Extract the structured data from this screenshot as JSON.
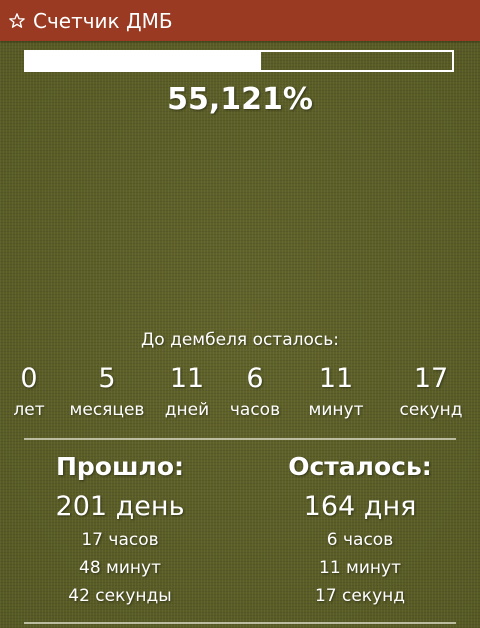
{
  "app_bar": {
    "icon": "star-outline-icon",
    "title": "Счетчик ДМБ",
    "color": "#9a3a22"
  },
  "progress": {
    "fraction": 0.55121,
    "percent_text": "55,121%"
  },
  "countdown": {
    "label": "До дембеля осталось:",
    "units": [
      {
        "value": "0",
        "label": "лет"
      },
      {
        "value": "5",
        "label": "месяцев"
      },
      {
        "value": "11",
        "label": "дней"
      },
      {
        "value": "6",
        "label": "часов"
      },
      {
        "value": "11",
        "label": "минут"
      },
      {
        "value": "17",
        "label": "секунд"
      }
    ]
  },
  "passed": {
    "heading": "Прошло:",
    "days": "201 день",
    "hours": "17 часов",
    "minutes": "48 минут",
    "seconds": "42 секунды"
  },
  "remaining": {
    "heading": "Осталось:",
    "days": "164 дня",
    "hours": "6 часов",
    "minutes": "11 минут",
    "seconds": "17 секунд"
  }
}
